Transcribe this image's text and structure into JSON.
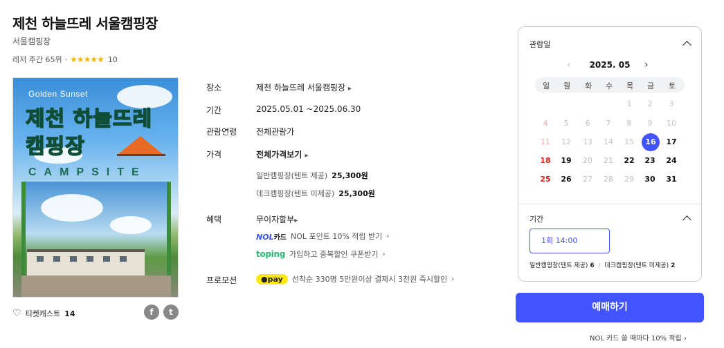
{
  "title": "제천 하늘뜨레 서울캠핑장",
  "subtitle": "서울캠핑장",
  "rank": "레저 주간 65위",
  "rank_sep": "·",
  "stars": "★★★★★",
  "rating_count": "10",
  "poster": {
    "tagline": "Golden Sunset",
    "title_line1": "제천 하늘뜨레",
    "title_line2": "캠핑장",
    "campsite": "CAMPSITE"
  },
  "info": {
    "place_label": "장소",
    "place_value": "제천 하늘뜨레 서울캠핑장",
    "period_label": "기간",
    "period_value": "2025.05.01 ~2025.06.30",
    "age_label": "관람연령",
    "age_value": "전체관람가",
    "price_label": "가격",
    "price_value": "전체가격보기",
    "prices": [
      {
        "name": "일반캠핑장(텐트 제공)",
        "amount": "25,300원"
      },
      {
        "name": "데크캠핑장(텐트 미제공)",
        "amount": "25,300원"
      }
    ],
    "benefit_label": "혜택",
    "benefit_value": "무이자할부",
    "nol_logo": "NOL",
    "nol_card": "카드",
    "nol_text": "NOL 포인트 10% 적립 받기",
    "toping_logo_a": "t",
    "toping_logo_b": "ping",
    "toping_text": "가입하고 중복할인 쿠폰받기",
    "promo_label": "프로모션",
    "pay_logo": "●pay",
    "promo_text": "선착순 330명 5만원이상 결제시 3천원 즉시할인"
  },
  "likes": {
    "label": "티켓캐스트",
    "count": "14"
  },
  "social": {
    "facebook": "f",
    "twitter": "t"
  },
  "panel": {
    "date_label": "관람일",
    "month": "2025. 05",
    "prev": "‹",
    "next": "›",
    "weekdays": [
      "일",
      "월",
      "화",
      "수",
      "목",
      "금",
      "토"
    ],
    "days": [
      [
        "",
        "",
        "",
        "",
        "1",
        "2",
        "3"
      ],
      [
        "4",
        "5",
        "6",
        "7",
        "8",
        "9",
        "10"
      ],
      [
        "11",
        "12",
        "13",
        "14",
        "15",
        "16",
        "17"
      ],
      [
        "18",
        "19",
        "20",
        "21",
        "22",
        "23",
        "24"
      ],
      [
        "25",
        "26",
        "27",
        "28",
        "29",
        "30",
        "31"
      ]
    ],
    "selected_day": "16",
    "period_label": "기간",
    "time_option": "1회 14:00",
    "seats": [
      {
        "name": "일반캠핑장(텐트 제공)",
        "count": "6"
      },
      {
        "name": "데크캠핑장(텐트 미제공)",
        "count": "2"
      }
    ],
    "seat_sep": "/"
  },
  "book_button": "예매하기",
  "nol_note": "NOL 카드 쓸 때마다 10% 적립 ›",
  "colors": {
    "accent": "#4154ff",
    "star": "#f5b50a",
    "sunday": "#e02020"
  }
}
